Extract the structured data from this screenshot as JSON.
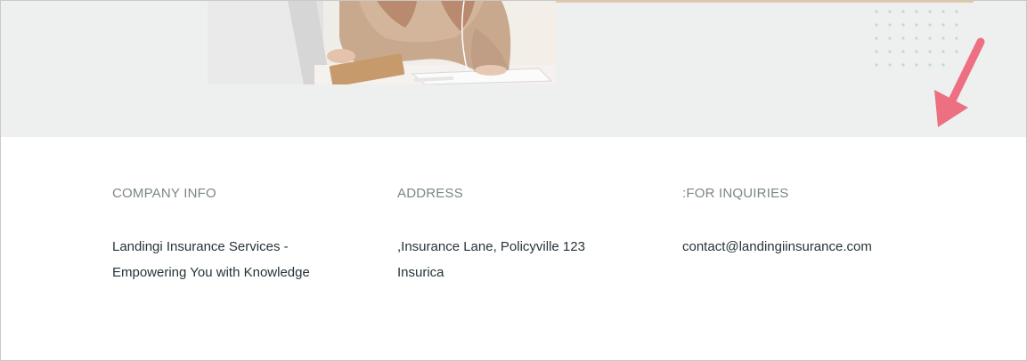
{
  "hero": {
    "photo_alt": "woman at desk with laptop",
    "accent_color": "#e8c9a2",
    "band_color": "#edf0ef",
    "arrow_color": "#ec6f82"
  },
  "footer": {
    "company": {
      "heading": "COMPANY INFO",
      "line1": "Landingi Insurance Services -",
      "line2": "Empowering You with Knowledge"
    },
    "address": {
      "heading": "ADDRESS",
      "line1": ",Insurance Lane, Policyville 123",
      "line2": "Insurica"
    },
    "inquiries": {
      "heading": ":FOR INQUIRIES",
      "email": "contact@landingiinsurance.com"
    }
  }
}
